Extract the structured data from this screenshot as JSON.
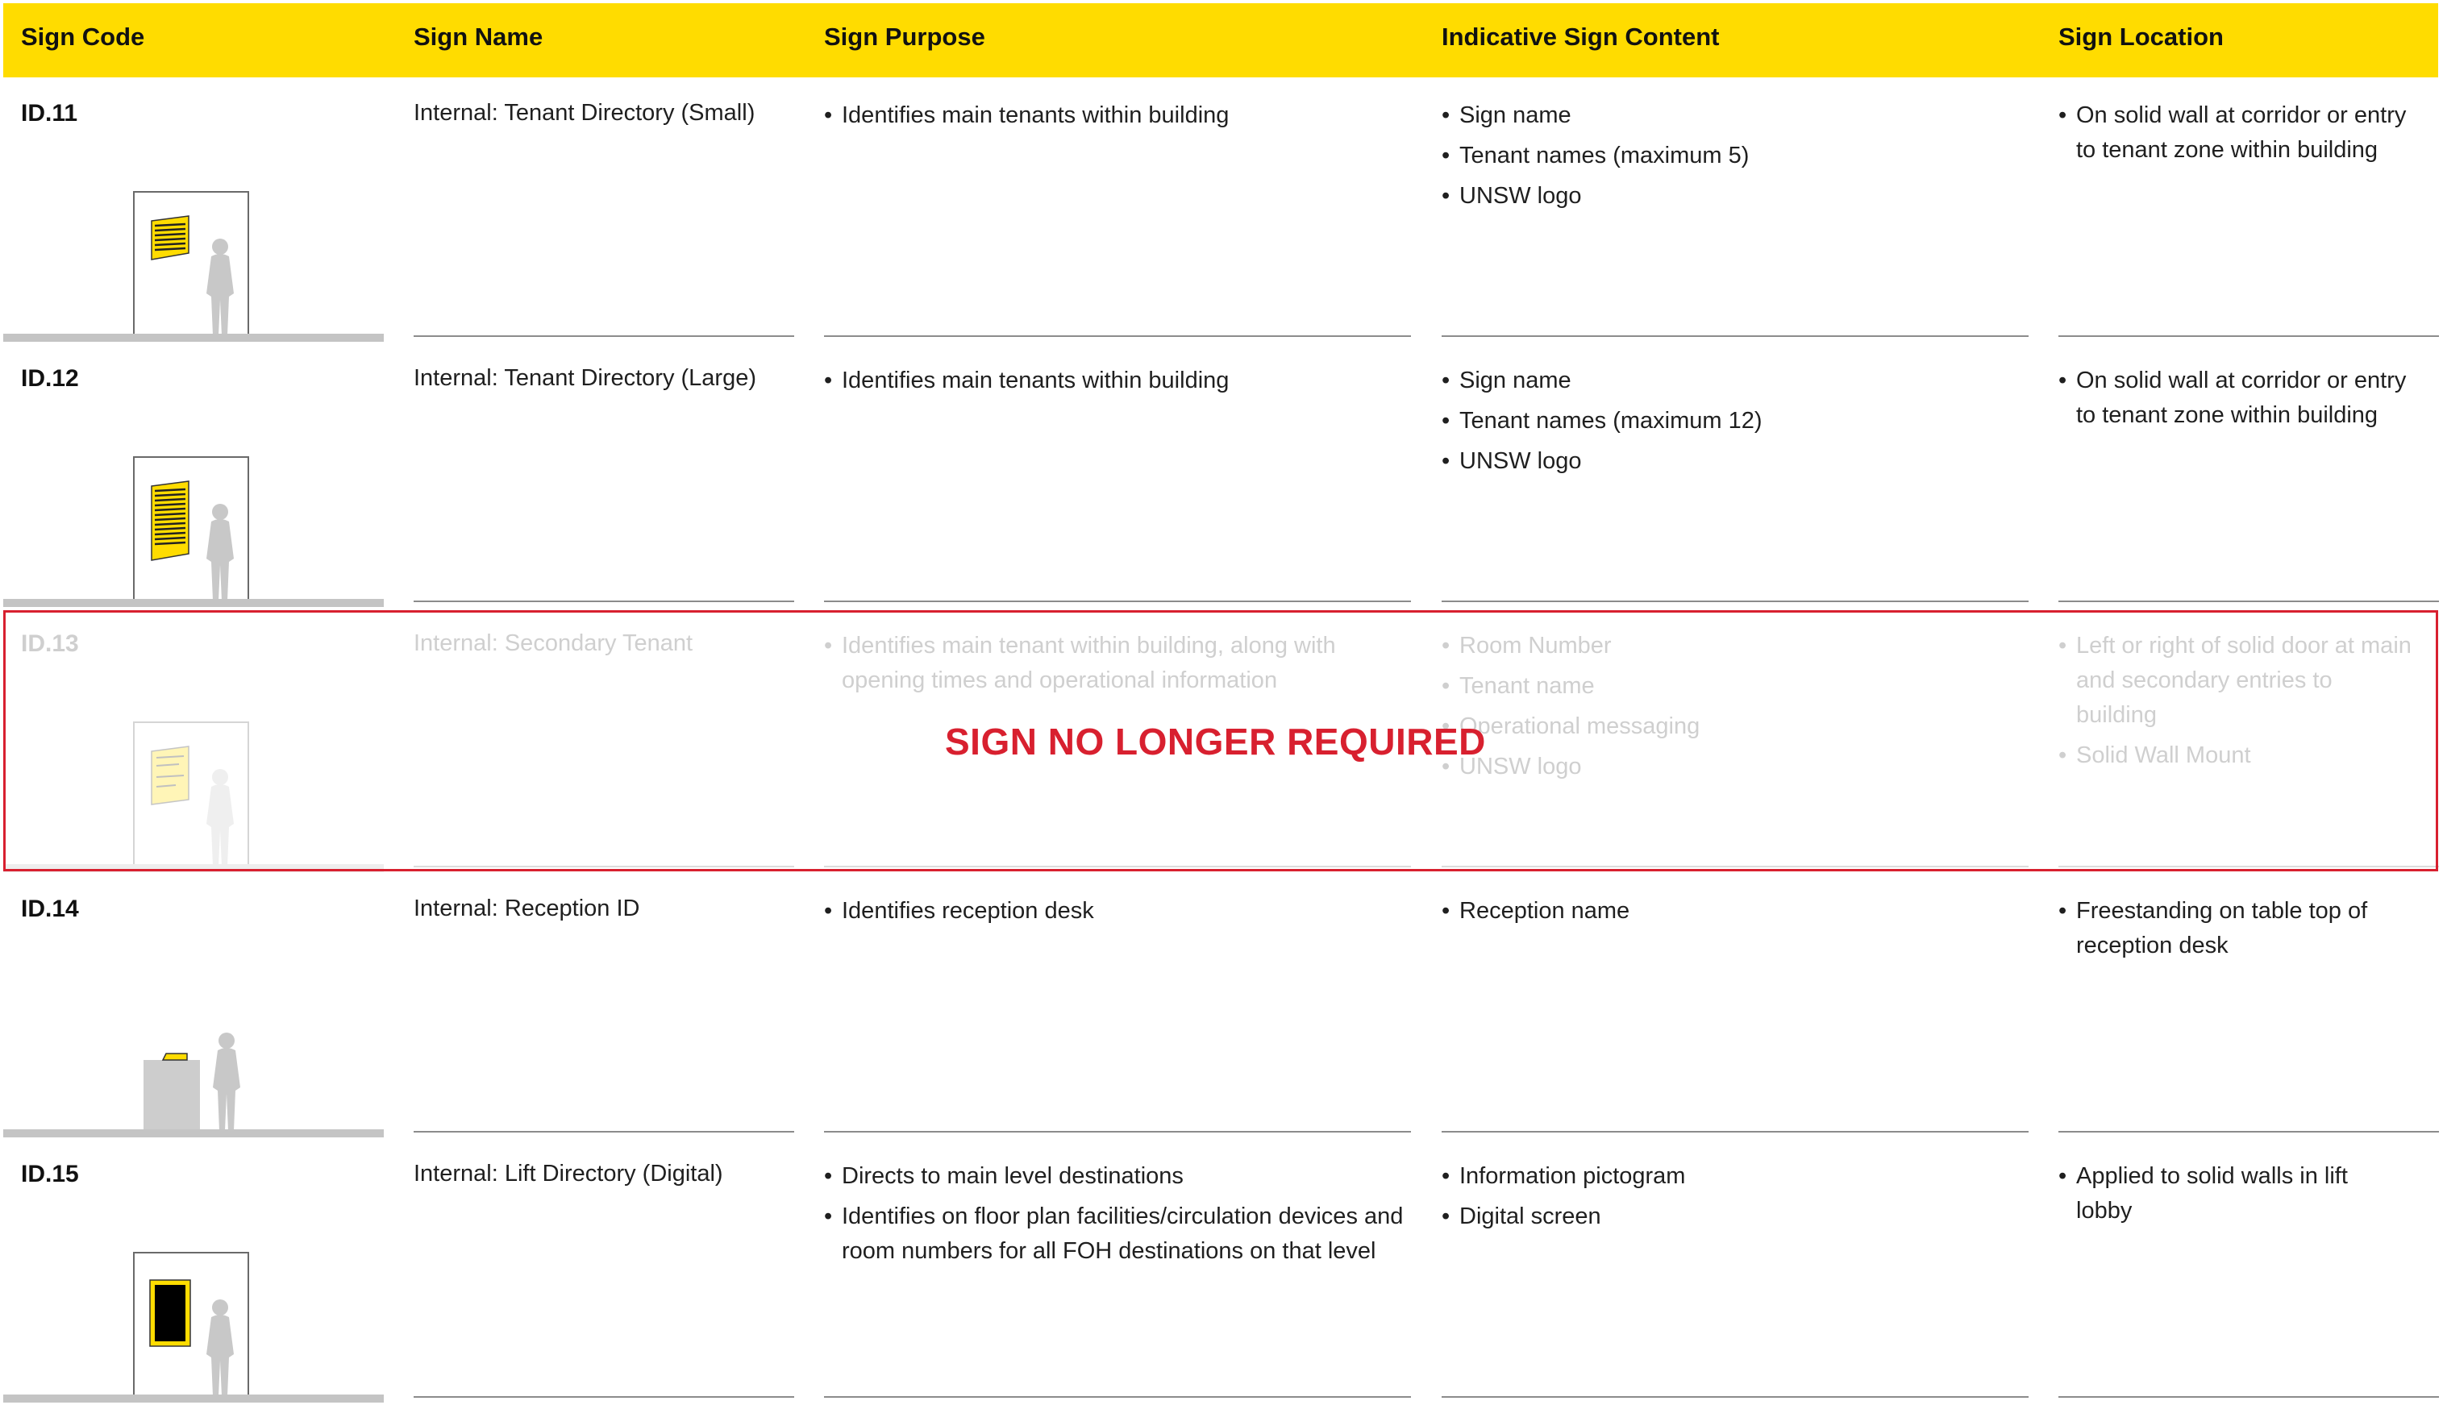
{
  "table": {
    "headers": {
      "sign_code": "Sign Code",
      "sign_name": "Sign Name",
      "sign_purpose": "Sign Purpose",
      "indicative_content": "Indicative Sign Content",
      "sign_location": "Sign Location"
    },
    "rows": [
      {
        "code": "ID.11",
        "name": "Internal: Tenant Directory (Small)",
        "purpose": [
          "Identifies main tenants within building"
        ],
        "content": [
          "Sign name",
          "Tenant names (maximum 5)",
          "UNSW logo"
        ],
        "location": [
          "On solid wall at corridor or entry to tenant zone within building"
        ],
        "status": "active",
        "illustration": "wall-sign-small-icon"
      },
      {
        "code": "ID.12",
        "name": "Internal: Tenant Directory (Large)",
        "purpose": [
          "Identifies main tenants within building"
        ],
        "content": [
          "Sign name",
          "Tenant names (maximum 12)",
          "UNSW logo"
        ],
        "location": [
          "On solid wall at corridor or entry to tenant zone within building"
        ],
        "status": "active",
        "illustration": "wall-sign-large-icon"
      },
      {
        "code": "ID.13",
        "name": "Internal: Secondary Tenant",
        "purpose": [
          "Identifies main tenant within building, along with opening times and operational information"
        ],
        "content": [
          "Room Number",
          "Tenant name",
          "Operational messaging",
          "UNSW logo"
        ],
        "location": [
          "Left or right of solid door at main and secondary entries to building",
          "Solid Wall Mount"
        ],
        "status": "removed",
        "illustration": "wall-sign-secondary-icon"
      },
      {
        "code": "ID.14",
        "name": "Internal: Reception ID",
        "purpose": [
          "Identifies reception desk"
        ],
        "content": [
          "Reception name"
        ],
        "location": [
          "Freestanding on table top of reception desk"
        ],
        "status": "active",
        "illustration": "reception-desk-sign-icon"
      },
      {
        "code": "ID.15",
        "name": "Internal: Lift Directory (Digital)",
        "purpose": [
          "Directs to main level destinations",
          "Identifies on floor plan facilities/circulation devices and room numbers for all FOH destinations on that level"
        ],
        "content": [
          "Information pictogram",
          "Digital screen"
        ],
        "location": [
          "Applied to solid walls in lift lobby"
        ],
        "status": "active",
        "illustration": "digital-screen-sign-icon"
      }
    ]
  },
  "notice": {
    "text": "SIGN NO LONGER REQUIRED",
    "color": "#d8202f"
  },
  "colors": {
    "header_bg": "#ffdc00",
    "sign_yellow": "#ffdc00",
    "figure_grey": "#c8c8c8",
    "dimmed_text": "#cfcfcf"
  }
}
